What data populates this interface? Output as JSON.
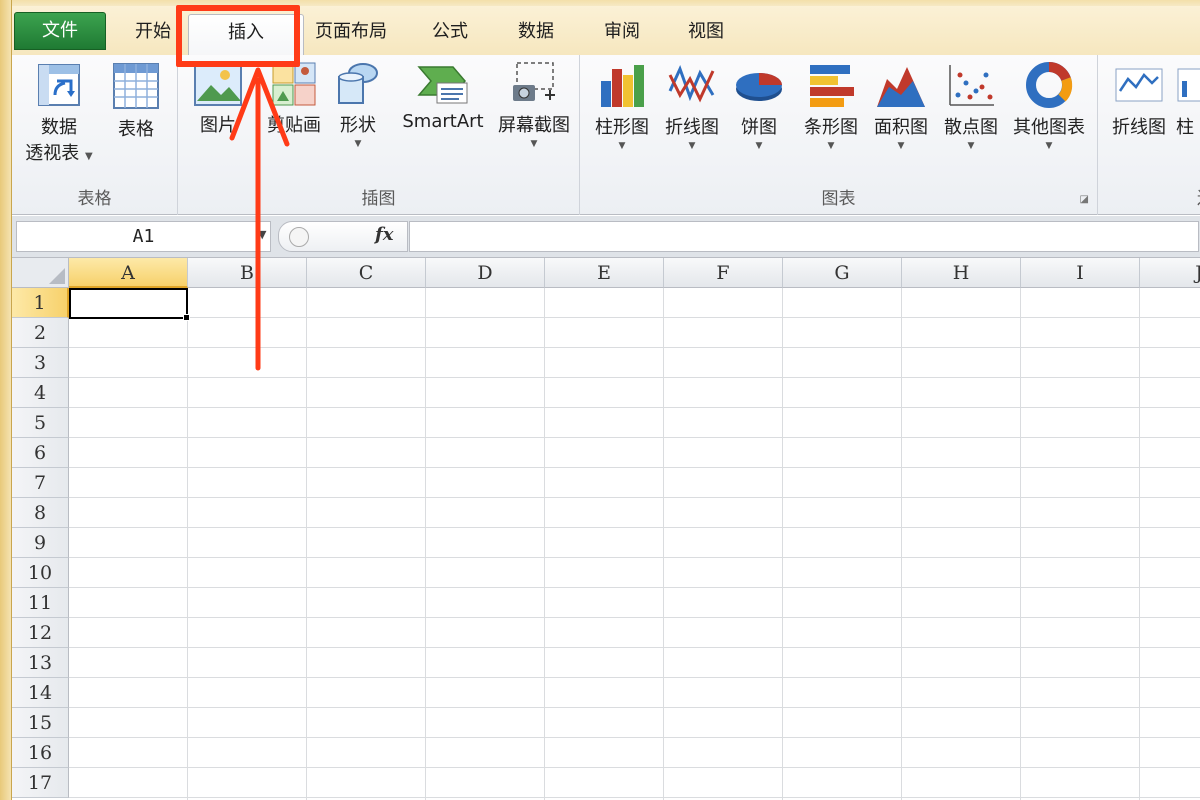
{
  "ribbon_tabs": {
    "file": "文件",
    "home": "开始",
    "insert": "插入",
    "page_layout": "页面布局",
    "formulas": "公式",
    "data": "数据",
    "review": "审阅",
    "view": "视图"
  },
  "groups": {
    "tables": {
      "title": "表格",
      "pivot_line1": "数据",
      "pivot_line2": "透视表",
      "table": "表格"
    },
    "illustrations": {
      "title": "插图",
      "picture": "图片",
      "clipart": "剪贴画",
      "shapes": "形状",
      "smartart": "SmartArt",
      "screenshot": "屏幕截图"
    },
    "charts": {
      "title": "图表",
      "column": "柱形图",
      "line": "折线图",
      "pie": "饼图",
      "bar": "条形图",
      "area": "面积图",
      "scatter": "散点图",
      "other": "其他图表"
    },
    "sparklines": {
      "title": "迷",
      "line": "折线图",
      "column_partial": "柱"
    }
  },
  "formula_bar": {
    "name_box": "A1",
    "fx": "fx",
    "formula": ""
  },
  "grid": {
    "columns": [
      "A",
      "B",
      "C",
      "D",
      "E",
      "F",
      "G",
      "H",
      "I",
      "J"
    ],
    "rows": [
      "1",
      "2",
      "3",
      "4",
      "5",
      "6",
      "7",
      "8",
      "9",
      "10",
      "11",
      "12",
      "13",
      "14",
      "15",
      "16",
      "17"
    ],
    "selected_cell": "A1"
  },
  "colors": {
    "file_tab": "#2e8b43",
    "annotation": "#ff3b17",
    "selection_header": "#f7d16b"
  }
}
